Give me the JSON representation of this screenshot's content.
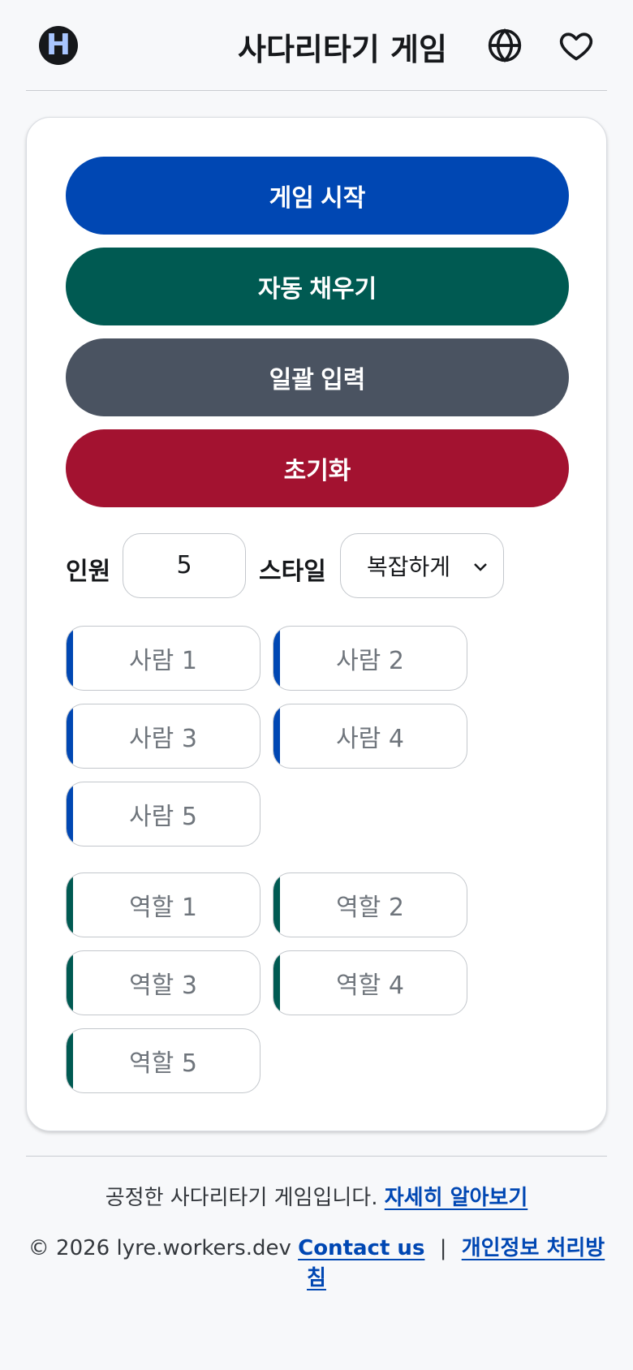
{
  "header": {
    "logo_letter": "H",
    "title": "사다리타기 게임",
    "globe_icon": "globe-icon",
    "heart_icon": "heart-outline-icon"
  },
  "actions": {
    "start_label": "게임 시작",
    "autofill_label": "자동 채우기",
    "bulk_input_label": "일괄 입력",
    "reset_label": "초기화"
  },
  "colors": {
    "start": "#0047b3",
    "autofill": "#005a52",
    "bulk_input": "#4a5361",
    "reset": "#a31230",
    "link": "#0047b3"
  },
  "settings": {
    "count_label": "인원",
    "count_value": "5",
    "style_label": "스타일",
    "style_selected": "복잡하게"
  },
  "players": {
    "placeholders": [
      "사람 1",
      "사람 2",
      "사람 3",
      "사람 4",
      "사람 5"
    ]
  },
  "roles": {
    "placeholders": [
      "역할 1",
      "역할 2",
      "역할 3",
      "역할 4",
      "역할 5"
    ]
  },
  "footer": {
    "tagline": "공정한 사다리타기 게임입니다.",
    "learn_more": "자세히 알아보기",
    "copyright": "© 2026 lyre.workers.dev",
    "contact": "Contact us",
    "separator": "|",
    "privacy": "개인정보 처리방침"
  }
}
